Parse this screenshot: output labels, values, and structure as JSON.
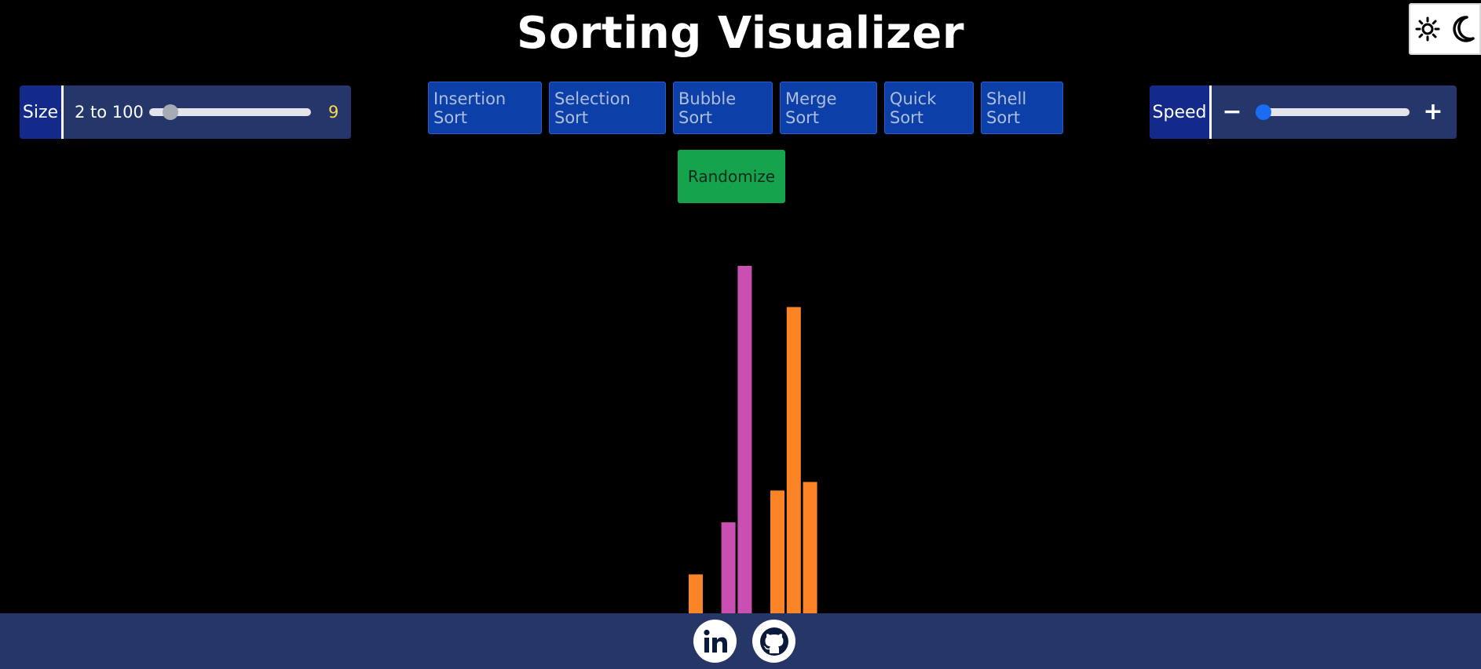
{
  "header": {
    "title": "Sorting Visualizer"
  },
  "theme_toggle": {
    "icons": [
      "sun-icon",
      "moon-icon"
    ]
  },
  "size_control": {
    "label": "Size",
    "range_text": "2 to 100",
    "value": "9",
    "slider_fraction": 0.09
  },
  "algorithms": [
    {
      "label": "Insertion Sort"
    },
    {
      "label": "Selection Sort"
    },
    {
      "label": "Bubble Sort"
    },
    {
      "label": "Merge Sort"
    },
    {
      "label": "Quick Sort"
    },
    {
      "label": "Shell Sort"
    }
  ],
  "randomize": {
    "label": "Randomize"
  },
  "speed_control": {
    "label": "Speed",
    "minus": "−",
    "plus": "+",
    "slider_fraction": 0.0
  },
  "chart_data": {
    "type": "bar",
    "title": "",
    "values": [
      50,
      0,
      117,
      447,
      0,
      158,
      394,
      169,
      0
    ],
    "colors": [
      "#fb8427",
      "#fb8427",
      "#c94fb1",
      "#c94fb1",
      "#fb8427",
      "#fb8427",
      "#fb8427",
      "#fb8427",
      "#fb8427"
    ],
    "ylim": [
      0,
      447
    ]
  },
  "footer": {
    "links": [
      "linkedin-icon",
      "github-icon"
    ]
  },
  "colors": {
    "background": "#000000",
    "panel": "#25366a",
    "label_bg": "#142a8a",
    "button": "#0c3fa8",
    "randomize": "#16a34e",
    "bar_default": "#fb8427",
    "bar_active": "#c94fb1",
    "size_value": "#ffd84a"
  }
}
